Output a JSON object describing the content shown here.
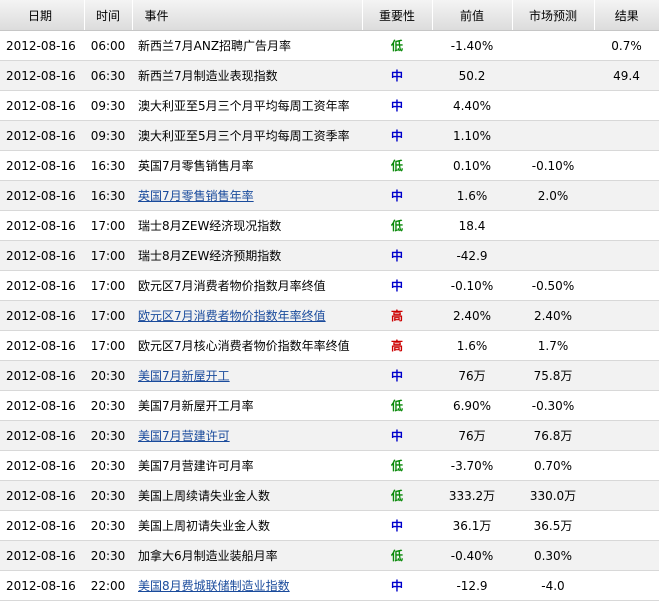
{
  "columns": {
    "date": "日期",
    "time": "时间",
    "event": "事件",
    "importance": "重要性",
    "previous": "前值",
    "forecast": "市场预测",
    "result": "结果"
  },
  "importance_colors": {
    "低": "#0a8a0a",
    "中": "#0000cc",
    "高": "#cc0000"
  },
  "rows": [
    {
      "date": "2012-08-16",
      "time": "06:00",
      "event": "新西兰7月ANZ招聘广告月率",
      "link": false,
      "importance": "低",
      "previous": "-1.40%",
      "forecast": "",
      "result": "0.7%"
    },
    {
      "date": "2012-08-16",
      "time": "06:30",
      "event": "新西兰7月制造业表现指数",
      "link": false,
      "importance": "中",
      "previous": "50.2",
      "forecast": "",
      "result": "49.4"
    },
    {
      "date": "2012-08-16",
      "time": "09:30",
      "event": "澳大利亚至5月三个月平均每周工资年率",
      "link": false,
      "importance": "中",
      "previous": "4.40%",
      "forecast": "",
      "result": ""
    },
    {
      "date": "2012-08-16",
      "time": "09:30",
      "event": "澳大利亚至5月三个月平均每周工资季率",
      "link": false,
      "importance": "中",
      "previous": "1.10%",
      "forecast": "",
      "result": ""
    },
    {
      "date": "2012-08-16",
      "time": "16:30",
      "event": "英国7月零售销售月率",
      "link": false,
      "importance": "低",
      "previous": "0.10%",
      "forecast": "-0.10%",
      "result": ""
    },
    {
      "date": "2012-08-16",
      "time": "16:30",
      "event": "英国7月零售销售年率",
      "link": true,
      "importance": "中",
      "previous": "1.6%",
      "forecast": "2.0%",
      "result": ""
    },
    {
      "date": "2012-08-16",
      "time": "17:00",
      "event": "瑞士8月ZEW经济现况指数",
      "link": false,
      "importance": "低",
      "previous": "18.4",
      "forecast": "",
      "result": ""
    },
    {
      "date": "2012-08-16",
      "time": "17:00",
      "event": "瑞士8月ZEW经济预期指数",
      "link": false,
      "importance": "中",
      "previous": "-42.9",
      "forecast": "",
      "result": ""
    },
    {
      "date": "2012-08-16",
      "time": "17:00",
      "event": "欧元区7月消费者物价指数月率终值",
      "link": false,
      "importance": "中",
      "previous": "-0.10%",
      "forecast": "-0.50%",
      "result": ""
    },
    {
      "date": "2012-08-16",
      "time": "17:00",
      "event": "欧元区7月消费者物价指数年率终值",
      "link": true,
      "importance": "高",
      "previous": "2.40%",
      "forecast": "2.40%",
      "result": ""
    },
    {
      "date": "2012-08-16",
      "time": "17:00",
      "event": "欧元区7月核心消费者物价指数年率终值",
      "link": false,
      "importance": "高",
      "previous": "1.6%",
      "forecast": "1.7%",
      "result": ""
    },
    {
      "date": "2012-08-16",
      "time": "20:30",
      "event": "美国7月新屋开工",
      "link": true,
      "importance": "中",
      "previous": "76万",
      "forecast": "75.8万",
      "result": ""
    },
    {
      "date": "2012-08-16",
      "time": "20:30",
      "event": "美国7月新屋开工月率",
      "link": false,
      "importance": "低",
      "previous": "6.90%",
      "forecast": "-0.30%",
      "result": ""
    },
    {
      "date": "2012-08-16",
      "time": "20:30",
      "event": "美国7月营建许可",
      "link": true,
      "importance": "中",
      "previous": "76万",
      "forecast": "76.8万",
      "result": ""
    },
    {
      "date": "2012-08-16",
      "time": "20:30",
      "event": "美国7月营建许可月率",
      "link": false,
      "importance": "低",
      "previous": "-3.70%",
      "forecast": "0.70%",
      "result": ""
    },
    {
      "date": "2012-08-16",
      "time": "20:30",
      "event": "美国上周续请失业金人数",
      "link": false,
      "importance": "低",
      "previous": "333.2万",
      "forecast": "330.0万",
      "result": ""
    },
    {
      "date": "2012-08-16",
      "time": "20:30",
      "event": "美国上周初请失业金人数",
      "link": false,
      "importance": "中",
      "previous": "36.1万",
      "forecast": "36.5万",
      "result": ""
    },
    {
      "date": "2012-08-16",
      "time": "20:30",
      "event": "加拿大6月制造业装船月率",
      "link": false,
      "importance": "低",
      "previous": "-0.40%",
      "forecast": "0.30%",
      "result": ""
    },
    {
      "date": "2012-08-16",
      "time": "22:00",
      "event": "美国8月费城联储制造业指数",
      "link": true,
      "importance": "中",
      "previous": "-12.9",
      "forecast": "-4.0",
      "result": ""
    }
  ]
}
